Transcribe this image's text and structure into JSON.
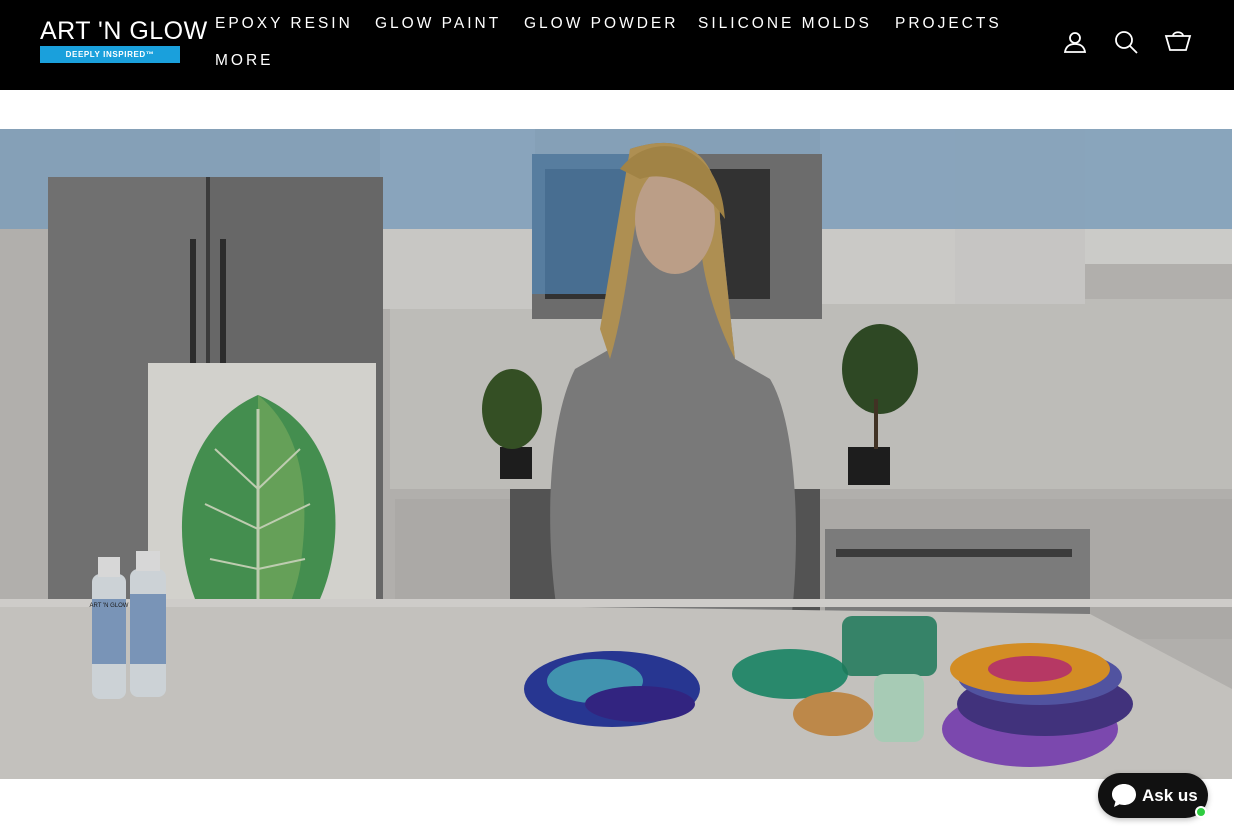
{
  "brand": {
    "name": "ART 'N GLOW",
    "tagline": "DEEPLY INSPIRED™",
    "accent_color": "#1aa0dc"
  },
  "nav": {
    "items": [
      {
        "label": "EPOXY RESIN"
      },
      {
        "label": "GLOW PAINT"
      },
      {
        "label": "GLOW POWDER"
      },
      {
        "label": "SILICONE MOLDS"
      },
      {
        "label": "PROJECTS"
      },
      {
        "label": "MORE"
      }
    ]
  },
  "header_actions": [
    {
      "icon": "user-icon",
      "aria": "LOG IN"
    },
    {
      "icon": "search-icon",
      "aria": "SEARCH"
    },
    {
      "icon": "cart-icon",
      "aria": "CART"
    }
  ],
  "hero": {
    "bottle_label": "ART 'N GLOW"
  },
  "chat": {
    "label": "Ask us",
    "status_color": "#2ecc40"
  }
}
